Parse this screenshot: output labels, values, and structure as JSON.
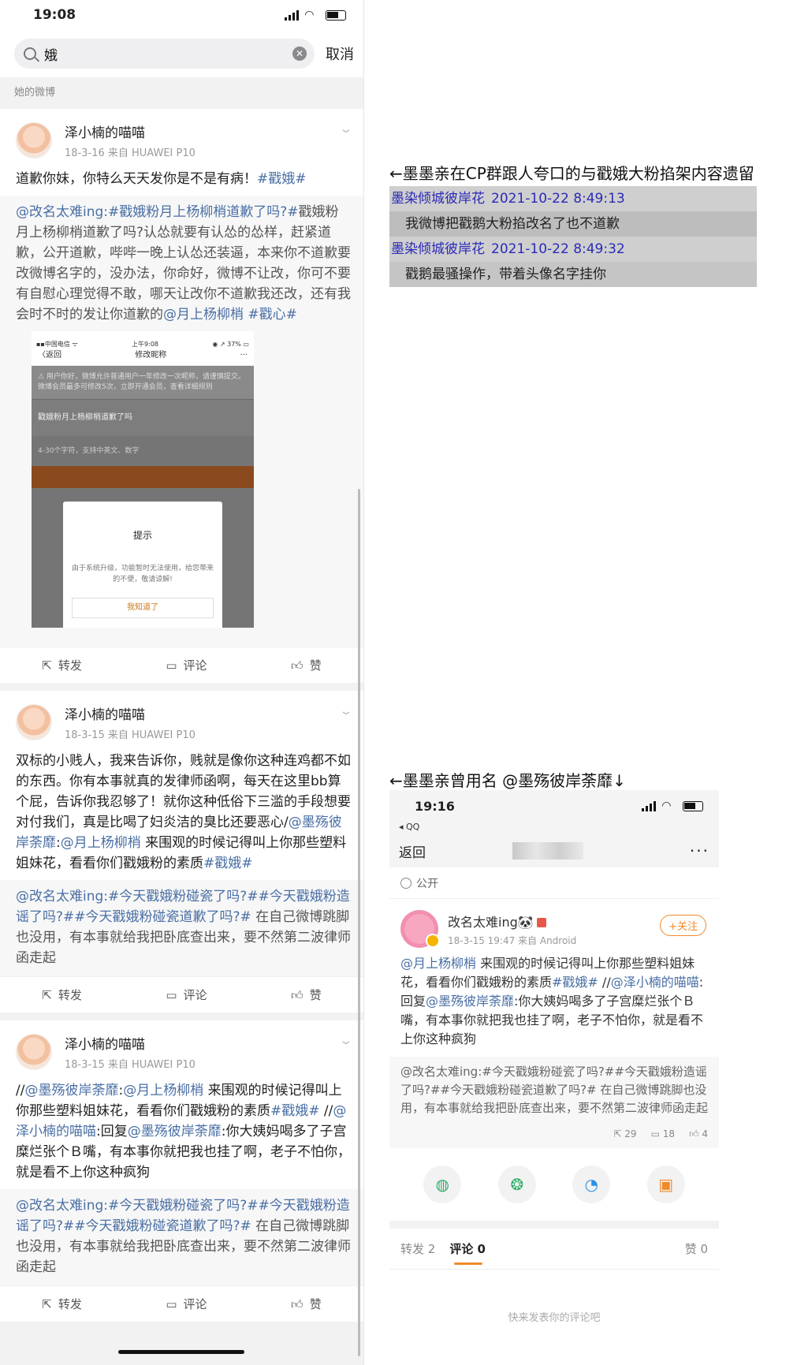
{
  "left": {
    "status": {
      "time": "19:08"
    },
    "search": {
      "query": "娥",
      "cancel": "取消"
    },
    "section_label": "她的微博",
    "actions": {
      "repost": "转发",
      "comment": "评论",
      "like": "赞"
    },
    "posts": [
      {
        "user": "泽小楠的喵喵",
        "date": "18-3-16  来自 HUAWEI P10",
        "text": "道歉你妹，你特么天天发你是不是有病！",
        "tag": "#戳娥#",
        "repost_mention": "@改名太难ing:",
        "repost_tag": "#戳娥粉月上杨柳梢道歉了吗?#",
        "repost_text": "戳娥粉月上杨柳梢道歉了吗?认怂就要有认怂的怂样，赶紧道歉，公开道歉，哔哔一晚上认怂还装逼，本来你不道歉要改微博名字的，没办法，你命好，微博不让改，你可不要有自慰心理觉得不敢，哪天让改你不道歉我还改，还有我会时不时的发让你道歉的",
        "repost_mention2": "@月上杨柳梢",
        "repost_tag2": "#戳心#",
        "embedded": {
          "carrier": "▪▪中国电信 ᯤ",
          "time": "上午9:08",
          "battery": "◉ ↗ 37% ▭",
          "back": "〈返回",
          "title": "修改昵称",
          "more": "···",
          "notice": "⚠ 用户你好，微博允许普通用户一年修改一次昵称，请谨慎提交。微博会员最多可修改5次，立即开通会员，查看详细规则",
          "name_value": "戳娥粉月上杨柳梢道歉了吗",
          "hint": "4-30个字符，支持中英文、数字",
          "dialog_title": "提示",
          "dialog_msg": "由于系统升级，功能暂时无法使用，给您带来的不便，敬请谅解!",
          "dialog_btn": "我知道了"
        }
      },
      {
        "user": "泽小楠的喵喵",
        "date": "18-3-15  来自 HUAWEI P10",
        "text": "双标的小贱人，我来告诉你，贱就是像你这种连鸡都不如的东西。你有本事就真的发律师函啊，每天在这里bb算个屁，告诉你我忍够了！就你这种低俗下三滥的手段想要对付我们，真是比喝了妇炎洁的臭比还要恶心/",
        "mention_a": "@墨殇彼岸荼靡",
        "mid": ":",
        "mention_b": "@月上杨柳梢",
        "text2": " 来围观的时候记得叫上你那些塑料姐妹花，看看你们戳娥粉的素质",
        "tag": "#戳娥#",
        "repost_mention": "@改名太难ing:",
        "repost_tag": "#今天戳娥粉碰瓷了吗?##今天戳娥粉造谣了吗?##今天戳娥粉碰瓷道歉了吗?#",
        "repost_text": " 在自己微博跳脚也没用，有本事就给我把卧底查出来，要不然第二波律师函走起"
      },
      {
        "user": "泽小楠的喵喵",
        "date": "18-3-15  来自 HUAWEI P10",
        "pre": "//",
        "mention_a": "@墨殇彼岸荼靡",
        "mid": ":",
        "mention_b": "@月上杨柳梢",
        "text1": " 来围观的时候记得叫上你那些塑料姐妹花，看看你们戳娥粉的素质",
        "tag": "#戳娥#",
        "pre2": " //",
        "mention_c": "@泽小楠的喵喵",
        "reply": ":回复",
        "mention_d": "@墨殇彼岸荼靡",
        "text2": ":你大姨妈喝多了子宫糜烂张个Ｂ嘴，有本事你就把我也挂了啊，老子不怕你，就是看不上你这种疯狗",
        "repost_mention": "@改名太难ing:",
        "repost_tag": "#今天戳娥粉碰瓷了吗?##今天戳娥粉造谣了吗?##今天戳娥粉碰瓷道歉了吗?#",
        "repost_text": " 在自己微博跳脚也没用，有本事就给我把卧底查出来，要不然第二波律师函走起"
      }
    ]
  },
  "right": {
    "caption1": "←墨墨亲在CP群跟人夸口的与戳娥大粉掐架内容遗留",
    "chat": [
      {
        "name": "墨染倾城彼岸花",
        "time": "2021-10-22 8:49:13",
        "msg": "我微博把戳鹅大粉掐改名了也不道歉"
      },
      {
        "name": "墨染倾城彼岸花",
        "time": "2021-10-22 8:49:32",
        "msg": "戳鹅最骚操作，带着头像名字挂你"
      }
    ],
    "caption2": "←墨墨亲曾用名 @墨殇彼岸荼靡↓",
    "phone2": {
      "time": "19:16",
      "app": "◂ QQ",
      "back": "返回",
      "more": "···",
      "public": "公开",
      "user": "改名太难ing🐼",
      "date": "18-3-15 19:47  来自 Android",
      "follow": "+关注",
      "mention_a": "@月上杨柳梢",
      "text1": " 来围观的时候记得叫上你那些塑料姐妹花，看看你们戳娥粉的素质",
      "tag": "#戳娥#",
      "pre": " //",
      "mention_b": "@泽小楠的喵喵",
      "reply": ":回复",
      "mention_c": "@墨殇彼岸荼靡",
      "text2": ":你大姨妈喝多了子宫糜烂张个Ｂ嘴，有本事你就把我也挂了啊，老子不怕你，就是看不上你这种疯狗",
      "repost": "@改名太难ing:#今天戳娥粉碰瓷了吗?##今天戳娥粉造谣了吗?##今天戳娥粉碰瓷道歉了吗?# 在自己微博跳脚也没用，有本事就给我把卧底查出来，要不然第二波律师函走起",
      "repost_count": "29",
      "comment_count": "18",
      "like_count": "4",
      "tab_repost": "转发 2",
      "tab_comment": "评论 0",
      "tab_like": "赞 0",
      "empty": "快来发表你的评论吧"
    }
  },
  "colors": {
    "link": "#4a6fa5",
    "accent": "#f08a2a",
    "chat_name": "#2a2ab8"
  }
}
